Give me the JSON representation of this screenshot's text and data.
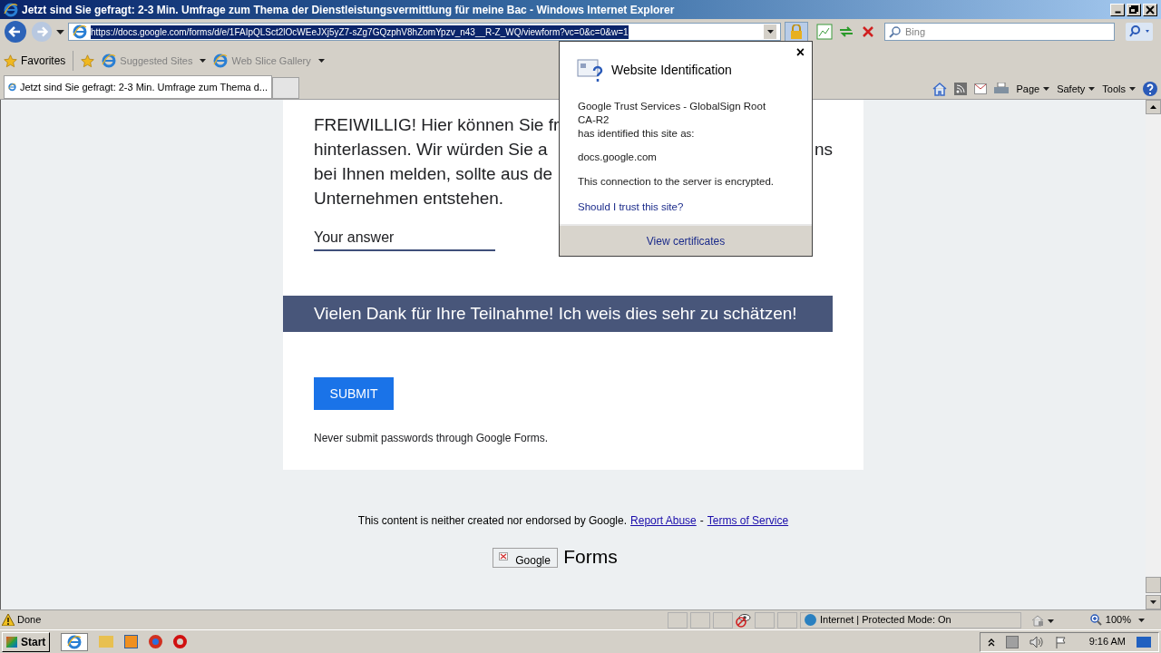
{
  "window": {
    "title": "Jetzt sind Sie gefragt: 2-3 Min. Umfrage zum Thema der Dienstleistungsvermittlung für meine Bac - Windows Internet Explorer"
  },
  "address_bar": {
    "url": "https://docs.google.com/forms/d/e/1FAIpQLSct2lOcWEeJXj5yZ7-sZg7GQzphV8hZomYpzv_n43__R-Z_WQ/viewform?vc=0&c=0&w=1"
  },
  "search": {
    "placeholder": "Bing"
  },
  "favorites_bar": {
    "favorites": "Favorites",
    "links": [
      "Suggested Sites",
      "Web Slice Gallery"
    ]
  },
  "tabs": [
    {
      "label": "Jetzt sind Sie gefragt: 2-3 Min. Umfrage zum Thema d...",
      "selected": true
    }
  ],
  "command_bar": [
    "Page",
    "Safety",
    "Tools"
  ],
  "form": {
    "question_lines": [
      "FREIWILLIG! Hier können Sie fr",
      "hinterlassen. Wir würden Sie a",
      "bei Ihnen melden, sollte aus de",
      "Unternehmen entstehen."
    ],
    "question_fragment": "ns",
    "answer": {
      "placeholder": "Your answer"
    },
    "banner": "Vielen Dank für Ihre Teilnahme! Ich weis dies sehr zu schätzen!",
    "submit": "SUBMIT",
    "note": "Never submit passwords through Google Forms."
  },
  "footer": {
    "text": "This content is neither created nor endorsed by Google.",
    "links": [
      "Report Abuse",
      "Terms of Service"
    ],
    "separator": "-",
    "logo_alt": "Google",
    "logo_text": "Forms"
  },
  "popup": {
    "title": "Website Identification",
    "close": "×",
    "lines": [
      "Google Trust Services - GlobalSign Root CA-R2",
      "has identified this site as:"
    ],
    "site": "docs.google.com",
    "encrypted": "This connection to the server is encrypted.",
    "trust_link": "Should I trust this site?",
    "certificates": "View certificates"
  },
  "status_bar": {
    "status": "Done",
    "zone": "Internet | Protected Mode: On",
    "zoom": "100%"
  },
  "taskbar": {
    "start": "Start",
    "clock": "9:16 AM"
  }
}
